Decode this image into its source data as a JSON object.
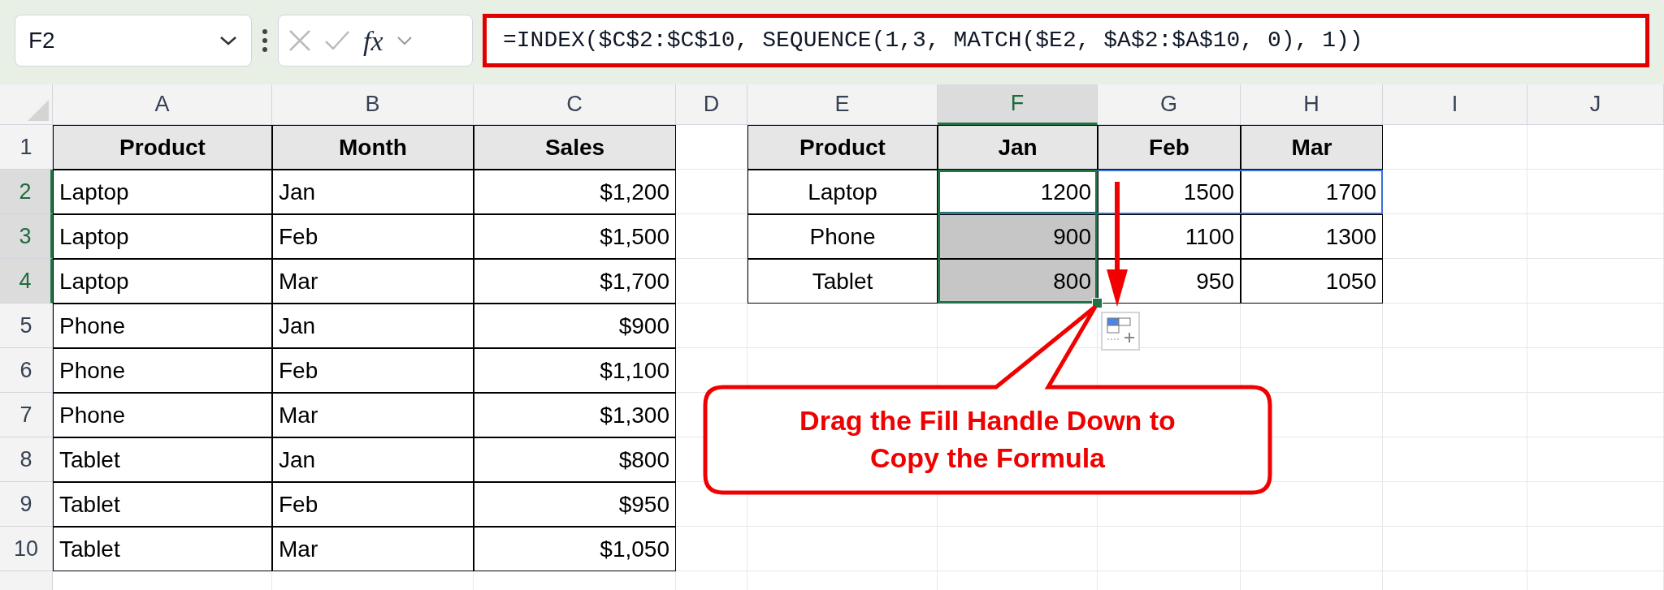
{
  "name_box": {
    "value": "F2"
  },
  "formula_bar": {
    "function_label": "fx",
    "formula": "=INDEX($C$2:$C$10, SEQUENCE(1,3, MATCH($E2, $A$2:$A$10, 0), 1))"
  },
  "columns": [
    {
      "label": "A",
      "selected": false
    },
    {
      "label": "B",
      "selected": false
    },
    {
      "label": "C",
      "selected": false
    },
    {
      "label": "D",
      "selected": false
    },
    {
      "label": "E",
      "selected": false
    },
    {
      "label": "F",
      "selected": true
    },
    {
      "label": "G",
      "selected": false
    },
    {
      "label": "H",
      "selected": false
    },
    {
      "label": "I",
      "selected": false
    },
    {
      "label": "J",
      "selected": false
    }
  ],
  "rows": [
    {
      "number": "1",
      "selected": false,
      "range_outline": false,
      "left": [
        {
          "text": "Product",
          "kind": "header"
        },
        {
          "text": "Month",
          "kind": "header"
        },
        {
          "text": "Sales",
          "kind": "header"
        }
      ],
      "right": [
        {
          "text": "Product",
          "kind": "header",
          "selected": false
        },
        {
          "text": "Jan",
          "kind": "header",
          "selected": false
        },
        {
          "text": "Feb",
          "kind": "header",
          "selected": false
        },
        {
          "text": "Mar",
          "kind": "header",
          "selected": false
        }
      ]
    },
    {
      "number": "2",
      "selected": true,
      "range_outline": true,
      "left": [
        {
          "text": "Laptop",
          "kind": "text"
        },
        {
          "text": "Jan",
          "kind": "text"
        },
        {
          "text": "$1,200",
          "kind": "number"
        }
      ],
      "right": [
        {
          "text": "Laptop",
          "kind": "label",
          "selected": false
        },
        {
          "text": "1200",
          "kind": "number",
          "selected": true
        },
        {
          "text": "1500",
          "kind": "number",
          "selected": false
        },
        {
          "text": "1700",
          "kind": "number",
          "selected": false
        }
      ]
    },
    {
      "number": "3",
      "selected": true,
      "range_outline": false,
      "left": [
        {
          "text": "Laptop",
          "kind": "text"
        },
        {
          "text": "Feb",
          "kind": "text"
        },
        {
          "text": "$1,500",
          "kind": "number"
        }
      ],
      "right": [
        {
          "text": "Phone",
          "kind": "label",
          "selected": false
        },
        {
          "text": "900",
          "kind": "number",
          "selected": true
        },
        {
          "text": "1100",
          "kind": "number",
          "selected": false
        },
        {
          "text": "1300",
          "kind": "number",
          "selected": false
        }
      ]
    },
    {
      "number": "4",
      "selected": true,
      "range_outline": false,
      "left": [
        {
          "text": "Laptop",
          "kind": "text"
        },
        {
          "text": "Mar",
          "kind": "text"
        },
        {
          "text": "$1,700",
          "kind": "number"
        }
      ],
      "right": [
        {
          "text": "Tablet",
          "kind": "label",
          "selected": false
        },
        {
          "text": "800",
          "kind": "number",
          "selected": true
        },
        {
          "text": "950",
          "kind": "number",
          "selected": false
        },
        {
          "text": "1050",
          "kind": "number",
          "selected": false
        }
      ]
    },
    {
      "number": "5",
      "selected": false,
      "range_outline": false,
      "left": [
        {
          "text": "Phone",
          "kind": "text"
        },
        {
          "text": "Jan",
          "kind": "text"
        },
        {
          "text": "$900",
          "kind": "number"
        }
      ]
    },
    {
      "number": "6",
      "selected": false,
      "range_outline": false,
      "left": [
        {
          "text": "Phone",
          "kind": "text"
        },
        {
          "text": "Feb",
          "kind": "text"
        },
        {
          "text": "$1,100",
          "kind": "number"
        }
      ]
    },
    {
      "number": "7",
      "selected": false,
      "range_outline": false,
      "left": [
        {
          "text": "Phone",
          "kind": "text"
        },
        {
          "text": "Mar",
          "kind": "text"
        },
        {
          "text": "$1,300",
          "kind": "number"
        }
      ]
    },
    {
      "number": "8",
      "selected": false,
      "range_outline": false,
      "left": [
        {
          "text": "Tablet",
          "kind": "text"
        },
        {
          "text": "Jan",
          "kind": "text"
        },
        {
          "text": "$800",
          "kind": "number"
        }
      ]
    },
    {
      "number": "9",
      "selected": false,
      "range_outline": false,
      "left": [
        {
          "text": "Tablet",
          "kind": "text"
        },
        {
          "text": "Feb",
          "kind": "text"
        },
        {
          "text": "$950",
          "kind": "number"
        }
      ]
    },
    {
      "number": "10",
      "selected": false,
      "range_outline": false,
      "left": [
        {
          "text": "Tablet",
          "kind": "text"
        },
        {
          "text": "Mar",
          "kind": "text"
        },
        {
          "text": "$1,050",
          "kind": "number"
        }
      ]
    }
  ],
  "callout": {
    "lines": [
      "Drag the Fill Handle Down to",
      "Copy the Formula"
    ]
  }
}
